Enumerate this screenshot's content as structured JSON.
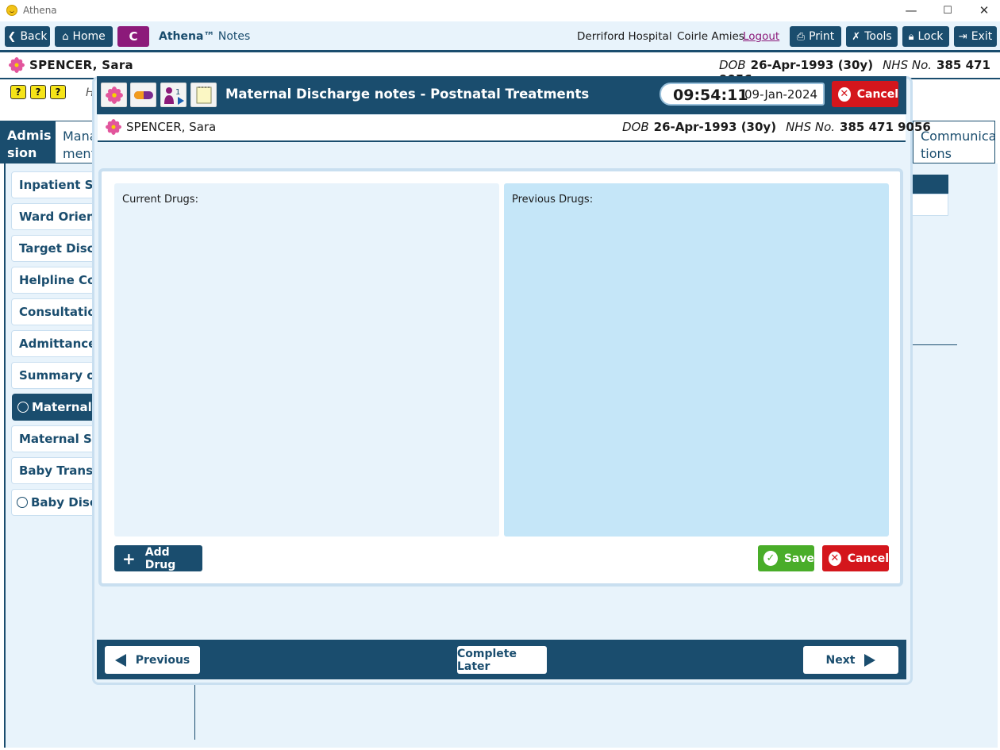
{
  "window": {
    "app_name": "Athena",
    "minimize": "—",
    "maximize": "☐",
    "close": "✕"
  },
  "toolbar": {
    "back": "Back",
    "home": "Home",
    "c_button": "C",
    "brand_name": "Athena™",
    "brand_suffix": "Notes",
    "hospital": "Derriford Hospital",
    "user": "Coirle Amies",
    "logout": "Logout",
    "print": "Print",
    "tools": "Tools",
    "lock": "Lock",
    "exit": "Exit"
  },
  "patient": {
    "name": "SPENCER, Sara",
    "dob_label": "DOB",
    "dob": "26-Apr-1993 (30y)",
    "nhs_label": "NHS No.",
    "nhs": "385 471 9056"
  },
  "help_icons": [
    "?",
    "?",
    "?"
  ],
  "background_hidden_letter": "H",
  "tabs": {
    "admission": "Admis sion",
    "management": "Mana ment",
    "communications": "Communica tions"
  },
  "nav_items": [
    {
      "label": "Inpatient Stay",
      "radio": false,
      "active": false
    },
    {
      "label": "Ward Orientat",
      "radio": false,
      "active": false
    },
    {
      "label": "Target Dischar",
      "radio": false,
      "active": false
    },
    {
      "label": "Helpline Cont",
      "radio": false,
      "active": false
    },
    {
      "label": "Consultation I",
      "radio": false,
      "active": false
    },
    {
      "label": "Admittance N",
      "radio": false,
      "active": false
    },
    {
      "label": "Summary of P",
      "radio": false,
      "active": false
    },
    {
      "label": "Maternal Di",
      "radio": true,
      "active": true
    },
    {
      "label": "Maternal Self",
      "radio": false,
      "active": false
    },
    {
      "label": "Baby Transfer",
      "radio": false,
      "active": false
    },
    {
      "label": "Baby Discha",
      "radio": true,
      "active": false
    }
  ],
  "modal": {
    "title": "Maternal Discharge notes - Postnatal Treatments",
    "time": "09:54:11",
    "date": "09-Jan-2024",
    "cancel_top": "Cancel",
    "current_drugs_label": "Current Drugs:",
    "previous_drugs_label": "Previous Drugs:",
    "add_drug": "Add Drug",
    "save": "Save",
    "cancel": "Cancel",
    "previous": "Previous",
    "complete_later": "Complete Later",
    "next": "Next"
  },
  "colors": {
    "primary": "#1a4d6e",
    "accent_purple": "#8c1a7a",
    "cancel_red": "#d4161c",
    "save_green": "#49ad29",
    "light_bg": "#e8f3fb",
    "previous_panel": "#c5e6f8"
  },
  "icons": {
    "flower": "flower-icon",
    "pill": "pill-icon",
    "mother_baby": "mother-baby-icon",
    "notes": "notes-icon"
  }
}
